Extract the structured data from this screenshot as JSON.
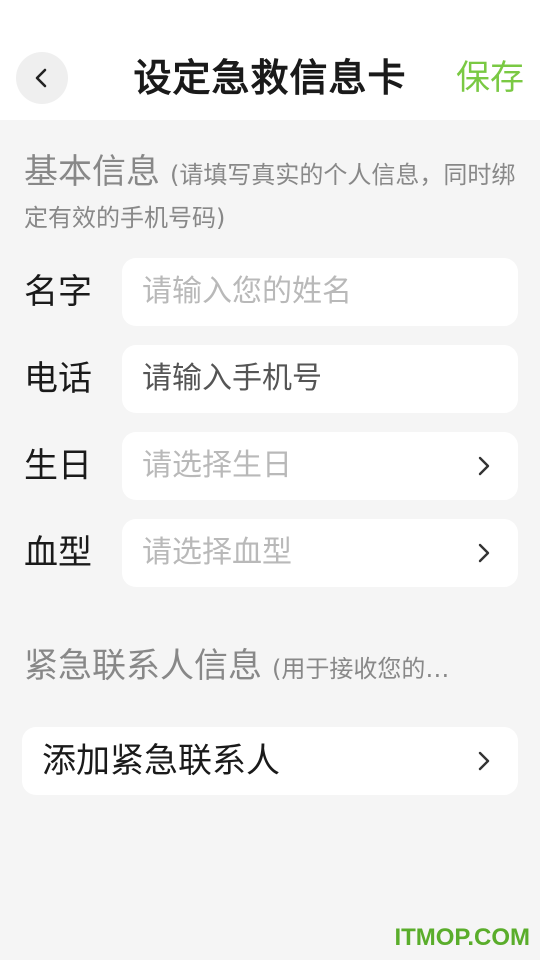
{
  "header": {
    "title": "设定急救信息卡",
    "save_label": "保存"
  },
  "basic_section": {
    "title": "基本信息",
    "note": "(请填写真实的个人信息，同时绑定有效的手机号码)"
  },
  "fields": [
    {
      "label": "名字",
      "placeholder": "请输入您的姓名"
    },
    {
      "label": "电话",
      "placeholder": "请输入手机号"
    },
    {
      "label": "生日",
      "placeholder": "请选择生日"
    },
    {
      "label": "血型",
      "placeholder": "请选择血型"
    }
  ],
  "emergency_section": {
    "title": "紧急联系人信息",
    "note": "(用于接收您的…"
  },
  "add_contact_label": "添加紧急联系人",
  "watermark": "ITMOP.COM",
  "colors": {
    "accent": "#7ac943",
    "background": "#f5f5f5",
    "card": "#ffffff"
  }
}
